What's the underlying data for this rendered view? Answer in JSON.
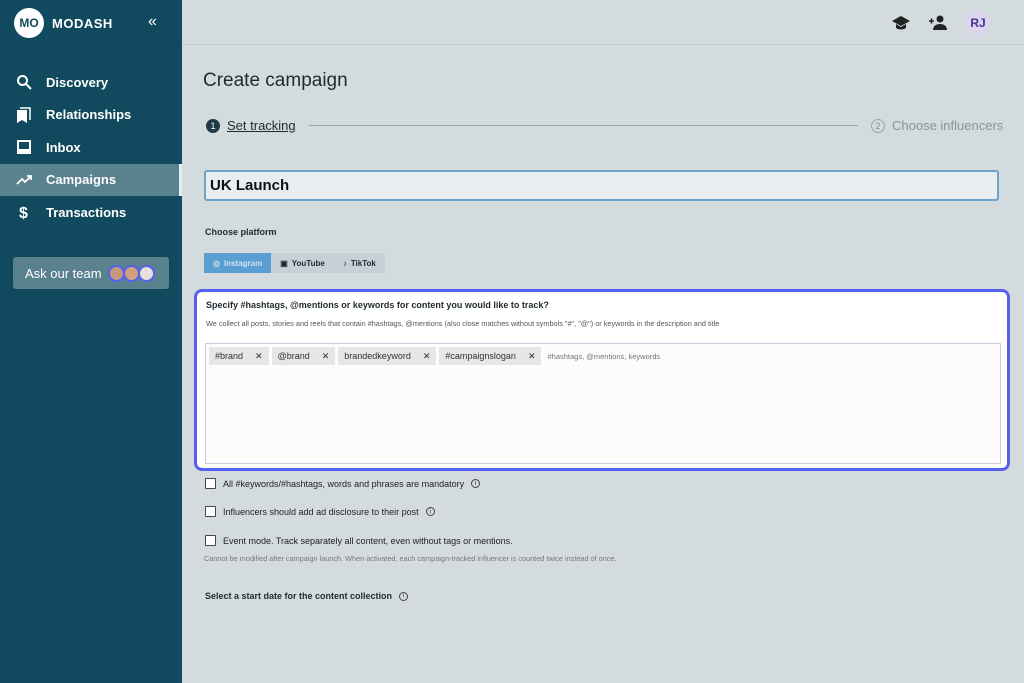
{
  "sidebar": {
    "logo": "MO",
    "brand": "MODASH",
    "collapse": "«",
    "items": [
      {
        "label": "Discovery",
        "icon": "search-icon"
      },
      {
        "label": "Relationships",
        "icon": "bookmark-icon"
      },
      {
        "label": "Inbox",
        "icon": "inbox-icon"
      },
      {
        "label": "Campaigns",
        "icon": "trending-icon",
        "active": true
      },
      {
        "label": "Transactions",
        "icon": "dollar-icon"
      }
    ],
    "ask_team": "Ask our team"
  },
  "header": {
    "avatar": "RJ",
    "icons": [
      "graduation-cap-icon",
      "add-user-icon"
    ]
  },
  "page": {
    "title": "Create campaign",
    "steps": [
      {
        "num": "1",
        "label": "Set tracking",
        "active": true
      },
      {
        "num": "2",
        "label": "Choose influencers"
      }
    ],
    "campaign_name": "UK Launch",
    "platform_label": "Choose platform",
    "platforms": [
      {
        "label": "Instagram",
        "active": true
      },
      {
        "label": "YouTube"
      },
      {
        "label": "TikTok"
      }
    ],
    "track": {
      "title": "Specify #hashtags, @mentions or keywords for content you would like to track?",
      "description": "We collect all posts, stories and reels that contain #hashtags, @mentions (also close matches without symbols \"#\", \"@\") or keywords in the description and title",
      "tags": [
        "#brand",
        "@brand",
        "brandedkeyword",
        "#campaignslogan"
      ],
      "placeholder": "#hashtags, @mentions, keywords"
    },
    "options": [
      "All #keywords/#hashtags, words and phrases are mandatory",
      "Influencers should add ad disclosure to their post",
      "Event mode. Track separately all content, even without tags or mentions."
    ],
    "event_hint": "Cannot be modified after campaign launch. When activated, each campaign-tracked influencer is counted twice instead of once.",
    "start_date_label": "Select a start date for the content collection"
  },
  "colors": {
    "sidebar": "#114a5e",
    "accent": "#5660ee",
    "platform_active": "#5a9ed2"
  }
}
